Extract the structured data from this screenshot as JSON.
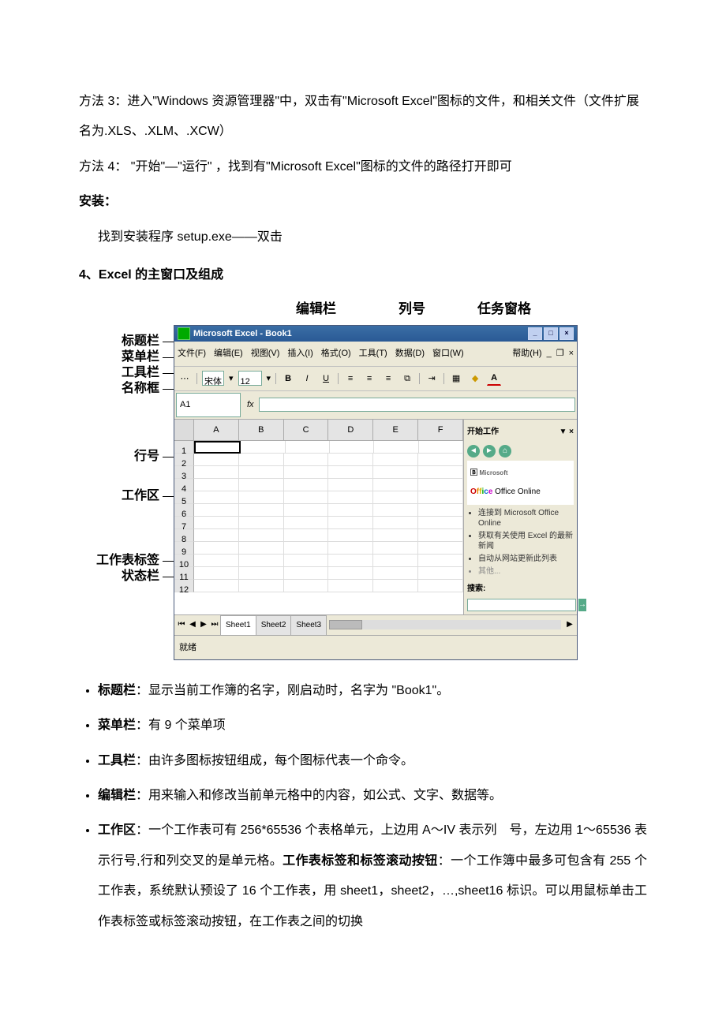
{
  "doc": {
    "p1": "方法 3：进入\"Windows 资源管理器\"中，双击有\"Microsoft Excel\"图标的文件，和相关文件（文件扩展名为.XLS、.XLM、.XCW）",
    "p2": "方法 4： \"开始\"—\"运行\" ，找到有\"Microsoft Excel\"图标的文件的路径打开即可",
    "install_head": "安装：",
    "install_body": "找到安装程序 setup.exe——双击",
    "section4": "4、Excel 的主窗口及组成"
  },
  "callouts_top": {
    "editbar": "编辑栏",
    "colnum": "列号",
    "taskpane": "任务窗格"
  },
  "callouts_left": {
    "title": "标题栏",
    "menu": "菜单栏",
    "tool": "工具栏",
    "namebox": "名称框",
    "rownum": "行号",
    "workarea": "工作区",
    "sheettab": "工作表标签",
    "status": "状态栏"
  },
  "excel": {
    "title": "Microsoft Excel - Book1",
    "menus": [
      "文件(F)",
      "编辑(E)",
      "视图(V)",
      "插入(I)",
      "格式(O)",
      "工具(T)",
      "数据(D)",
      "窗口(W)",
      "帮助(H)"
    ],
    "font": "宋体",
    "fontsize": "12",
    "namebox": "A1",
    "cols": [
      "A",
      "B",
      "C",
      "D",
      "E",
      "F"
    ],
    "rows": [
      "1",
      "2",
      "3",
      "4",
      "5",
      "6",
      "7",
      "8",
      "9",
      "10",
      "11",
      "12"
    ],
    "taskpane": {
      "head": "开始工作",
      "office_online": "Office Online",
      "links": [
        "连接到 Microsoft Office Online",
        "获取有关使用 Excel 的最新新闻",
        "自动从网站更新此列表",
        "其他..."
      ],
      "search": "搜索:"
    },
    "sheets": [
      "Sheet1",
      "Sheet2",
      "Sheet3"
    ],
    "status": "就绪"
  },
  "bullets": {
    "b1_lead": "标题栏",
    "b1": "：显示当前工作簿的名字，刚启动时，名字为 \"Book1\"。",
    "b2_lead": "菜单栏",
    "b2": "：有 9 个菜单项",
    "b3_lead": "工具栏",
    "b3": "：由许多图标按钮组成，每个图标代表一个命令。",
    "b4_lead": "编辑栏",
    "b4": "：用来输入和修改当前单元格中的内容，如公式、文字、数据等。",
    "b5_lead": "工作区",
    "b5a": "：一个工作表可有 256*65536 个表格单元，上边用 A～IV 表示列　号，左边用 1～65536 表示行号,行和列交叉的是单元格。",
    "b5b_lead": "工作表标签和标签滚动按钮",
    "b5b": "：一个工作簿中最多可包含有 255 个工作表，系统默认预设了 16 个工作表，用 sheet1，sheet2，…,sheet16 标识。可以用鼠标单击工作表标签或标签滚动按钮，在工作表之间的切换"
  }
}
